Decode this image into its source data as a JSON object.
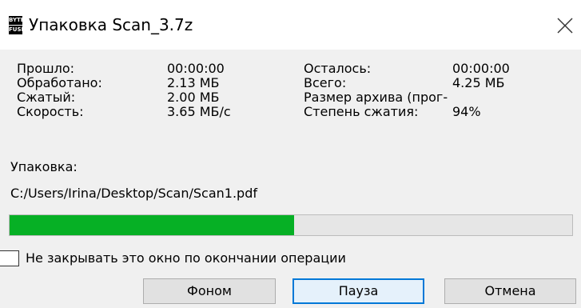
{
  "window": {
    "title": "Упаковка Scan_3.7z",
    "icon_top": "BYTE",
    "icon_bottom": "FUSE"
  },
  "stats": {
    "left": [
      {
        "label": "Прошло:",
        "value": "00:00:00"
      },
      {
        "label": "Обработано:",
        "value": "2.13 МБ"
      },
      {
        "label": "Сжатый:",
        "value": "2.00 МБ"
      },
      {
        "label": "Скорость:",
        "value": "3.65 МБ/с"
      }
    ],
    "right": [
      {
        "label": "Осталось:",
        "value": "00:00:00"
      },
      {
        "label": "Всего:",
        "value": "4.25 МБ"
      },
      {
        "label": "Размер архива (прог-",
        "value": ""
      },
      {
        "label": "Степень сжатия:",
        "value": "94%"
      }
    ]
  },
  "operation": {
    "label": "Упаковка:",
    "file": "C:/Users/Irina/Desktop/Scan/Scan1.pdf"
  },
  "progress": {
    "fraction": 0.505,
    "fill_color": "#06b025"
  },
  "checkbox": {
    "label": "Не закрывать это окно по окончании операции",
    "checked": false
  },
  "buttons": {
    "background": "Фоном",
    "pause": "Пауза",
    "cancel": "Отмена"
  },
  "icons": {
    "close": "close-icon",
    "app": "app-icon"
  }
}
